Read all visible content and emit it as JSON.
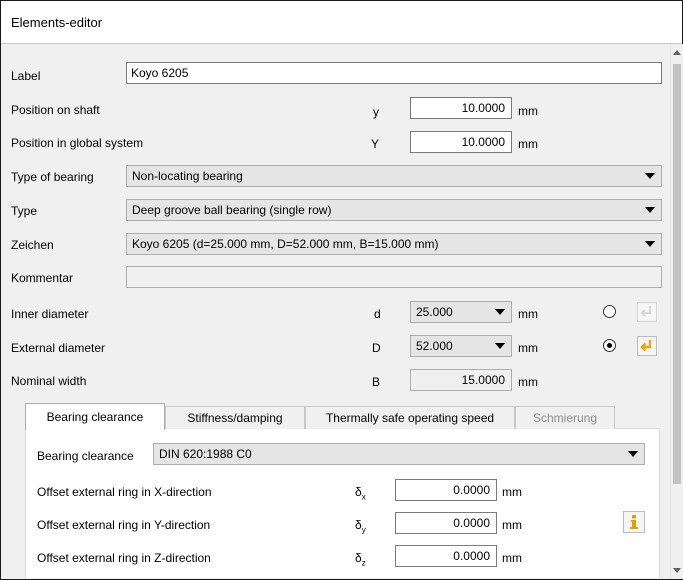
{
  "window": {
    "title": "Elements-editor"
  },
  "label_row": {
    "label": "Label",
    "value": "Koyo 6205"
  },
  "position_shaft": {
    "label": "Position on shaft",
    "symbol": "y",
    "value": "10.0000",
    "unit": "mm"
  },
  "position_global": {
    "label": "Position in global system",
    "symbol": "Y",
    "value": "10.0000",
    "unit": "mm"
  },
  "bearing_type": {
    "label": "Type of bearing",
    "value": "Non-locating bearing"
  },
  "type": {
    "label": "Type",
    "value": "Deep groove ball bearing (single row)"
  },
  "zeichen": {
    "label": "Zeichen",
    "value": "Koyo 6205 (d=25.000 mm, D=52.000 mm, B=15.000 mm)"
  },
  "kommentar": {
    "label": "Kommentar",
    "value": ""
  },
  "inner_diameter": {
    "label": "Inner diameter",
    "symbol": "d",
    "value": "25.000",
    "unit": "mm",
    "selected": false
  },
  "external_diameter": {
    "label": "External diameter",
    "symbol": "D",
    "value": "52.000",
    "unit": "mm",
    "selected": true
  },
  "nominal_width": {
    "label": "Nominal width",
    "symbol": "B",
    "value": "15.0000",
    "unit": "mm"
  },
  "tabs": [
    {
      "label": "Bearing clearance",
      "active": true
    },
    {
      "label": "Stiffness/damping",
      "active": false
    },
    {
      "label": "Thermally safe operating speed",
      "active": false
    },
    {
      "label": "Schmierung",
      "active": false,
      "disabled": true
    }
  ],
  "clearance": {
    "label": "Bearing clearance",
    "value": "DIN 620:1988 C0",
    "offsets": [
      {
        "label": "Offset external ring in X-direction",
        "symbol": "δ",
        "sub": "x",
        "value": "0.0000",
        "unit": "mm"
      },
      {
        "label": "Offset external ring in Y-direction",
        "symbol": "δ",
        "sub": "y",
        "value": "0.0000",
        "unit": "mm"
      },
      {
        "label": "Offset external ring in Z-direction",
        "symbol": "δ",
        "sub": "z",
        "value": "0.0000",
        "unit": "mm"
      }
    ]
  },
  "colors": {
    "accent_arrow": "#f0a30a",
    "info_icon": "#e0a000",
    "panel_bg": "#f0f0f0"
  },
  "icons": {
    "apply_disabled": "return-arrow-icon",
    "apply_active": "return-arrow-icon",
    "info": "info-icon"
  }
}
